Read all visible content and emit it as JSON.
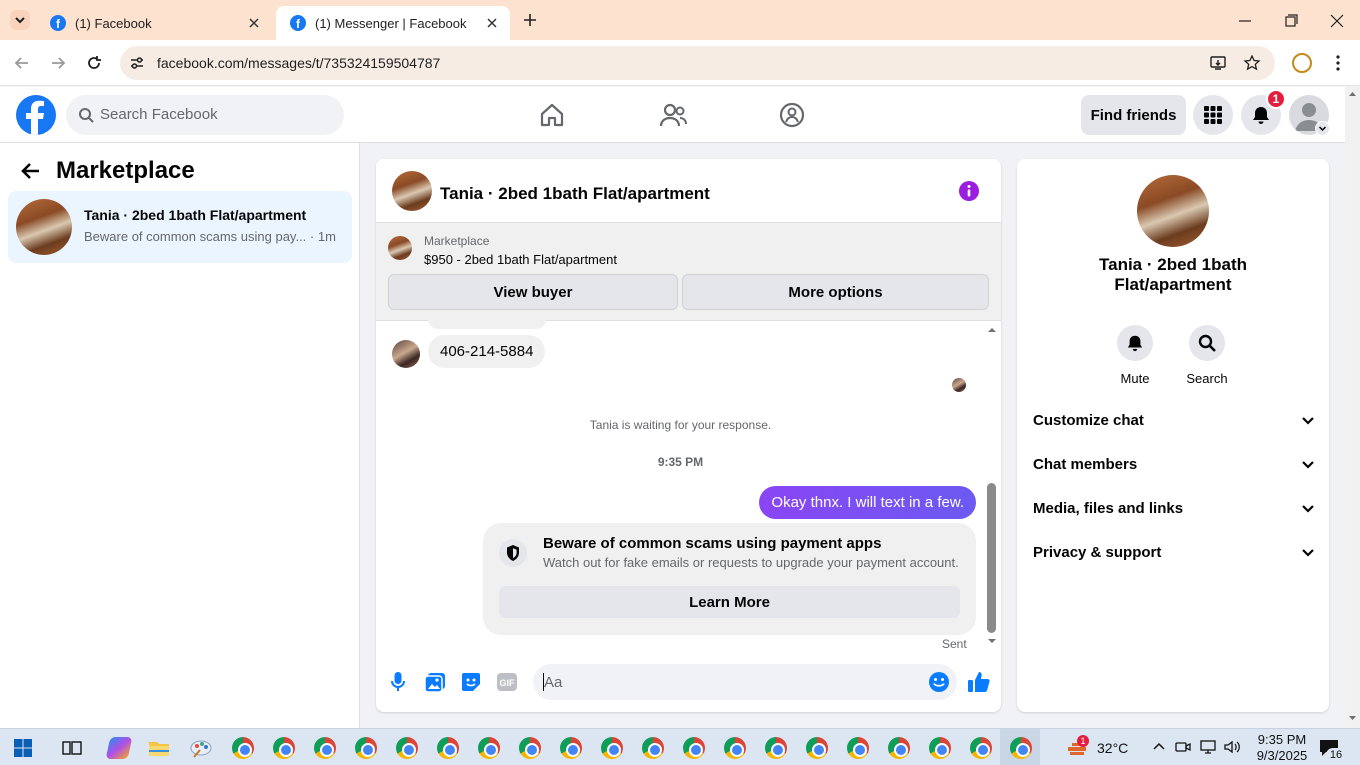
{
  "browser": {
    "tabs": [
      {
        "title": "(1) Facebook",
        "active": false
      },
      {
        "title": "(1) Messenger | Facebook",
        "active": true
      }
    ],
    "url": "facebook.com/messages/t/735324159504787"
  },
  "header": {
    "search_placeholder": "Search Facebook",
    "find_friends": "Find friends",
    "notification_count": "1"
  },
  "left_panel": {
    "title": "Marketplace",
    "conversations": [
      {
        "name": "Tania · 2bed 1bath Flat/apartment",
        "preview": "Beware of common scams using pay...",
        "time": "· 1m"
      }
    ]
  },
  "chat": {
    "title": "Tania · 2bed 1bath Flat/apartment",
    "listing_label": "Marketplace",
    "listing_item": "$950 - 2bed 1bath Flat/apartment",
    "view_buyer": "View buyer",
    "more_options": "More options",
    "messages": {
      "incoming_phone": "406-214-5884",
      "waiting": "Tania is waiting for your response.",
      "timestamp": "9:35 PM",
      "outgoing": "Okay thnx. I will text in a few.",
      "status": "Sent"
    },
    "scam_notice": {
      "heading": "Beware of common scams using payment apps",
      "body": "Watch out for fake emails or requests to upgrade your payment account.",
      "button": "Learn More"
    },
    "composer_placeholder": "Aa"
  },
  "right_panel": {
    "name": "Tania · 2bed 1bath Flat/apartment",
    "actions": [
      {
        "label": "Mute",
        "icon": "bell-icon"
      },
      {
        "label": "Search",
        "icon": "search-icon"
      }
    ],
    "sections": [
      "Customize chat",
      "Chat members",
      "Media, files and links",
      "Privacy & support"
    ]
  },
  "taskbar": {
    "weather": "32°C",
    "time": "9:35 PM",
    "date": "9/3/2025",
    "notifications": "16",
    "weather_badge": "1"
  },
  "colors": {
    "fb_blue": "#1877f2",
    "accent_purple": "#8a45f5",
    "tab_strip": "#fde2cf"
  }
}
